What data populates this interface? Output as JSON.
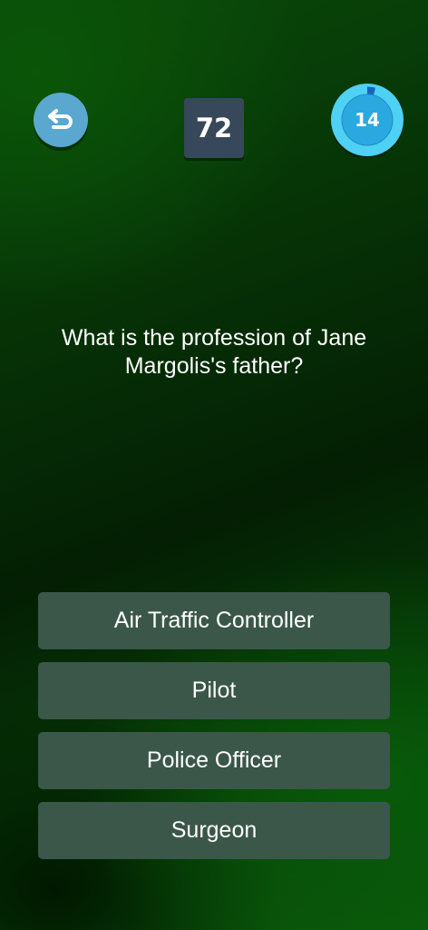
{
  "header": {
    "back_icon": "undo-arrow-icon",
    "question_number": "72",
    "timer": {
      "seconds_left": "14",
      "progress_fraction": 0.96,
      "ring_color": "#4fd0f5",
      "inner_color": "#2aa9e0",
      "elapsed_color": "#1565c0"
    }
  },
  "question": {
    "text": "What is the profession of Jane Margolis's father?"
  },
  "answers": [
    {
      "label": "Air Traffic Controller"
    },
    {
      "label": "Pilot"
    },
    {
      "label": "Police Officer"
    },
    {
      "label": "Surgeon"
    }
  ],
  "colors": {
    "back_button": "#5aa8d0",
    "counter_bg": "#36485a",
    "answer_bg": "#3a574a"
  }
}
